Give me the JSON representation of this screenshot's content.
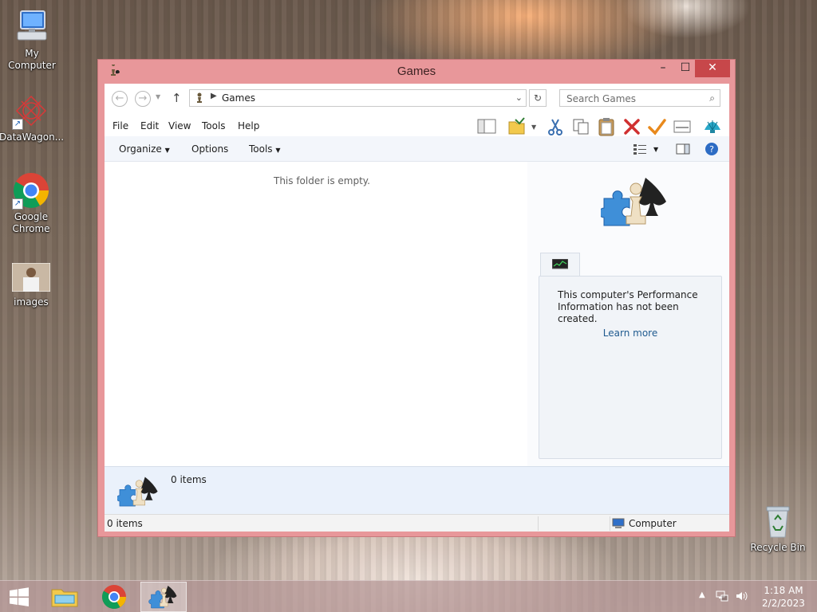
{
  "desktop": {
    "icons": [
      {
        "label": "My Computer"
      },
      {
        "label": "DataWagon..."
      },
      {
        "label": "Google Chrome"
      },
      {
        "label": "images"
      },
      {
        "label": "Recycle Bin"
      }
    ]
  },
  "window": {
    "title": "Games",
    "controls": {
      "minimize": "–",
      "maximize": "☐",
      "close": "✕"
    },
    "address": {
      "path": "Games",
      "search_placeholder": "Search Games"
    },
    "menu": [
      "File",
      "Edit",
      "View",
      "Tools",
      "Help"
    ],
    "commands": {
      "organize": "Organize",
      "options": "Options",
      "tools": "Tools"
    },
    "content": {
      "empty_message": "This folder is empty."
    },
    "preview": {
      "perf_text": "This computer's Performance Information has not been created.",
      "learn_more": "Learn more"
    },
    "details": {
      "item_count": "0 items"
    },
    "status": {
      "items": "0 items",
      "location": "Computer"
    }
  },
  "taskbar": {
    "time": "1:18 AM",
    "date": "2/2/2023"
  },
  "icons": {
    "back": "back-arrow-icon",
    "forward": "forward-arrow-icon",
    "up": "up-arrow-icon",
    "refresh": "refresh-icon",
    "search": "search-icon"
  }
}
